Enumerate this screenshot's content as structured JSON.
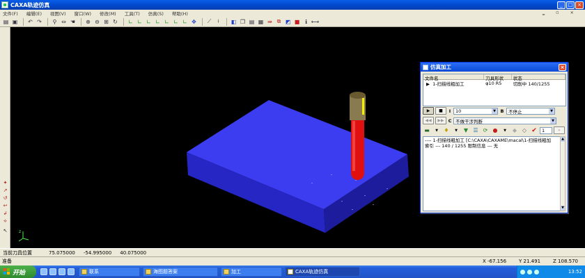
{
  "window": {
    "title": "CAXA轨迹仿真",
    "min": "_",
    "max": "□",
    "close": "×"
  },
  "menu": {
    "items": [
      "文件(F)",
      "编辑(E)",
      "视图(V)",
      "窗口(W)",
      "修改(M)",
      "工具(T)",
      "仿真(S)",
      "帮助(H)"
    ]
  },
  "coords": {
    "label": "当前刀具位置",
    "x": "75.075000",
    "y": "-54.995000",
    "z": "40.075000"
  },
  "status": {
    "ready": "准备",
    "x": "X  -67.156",
    "y": "Y  21.491",
    "z": "Z  108.570"
  },
  "dialog": {
    "title": "仿真加工",
    "close": "×",
    "headers": [
      "文件名",
      "刀具形状",
      "状态"
    ],
    "row": {
      "name": "1-扫描线粗加工",
      "tool": "φ10 R5",
      "state": "切削中 140/1255"
    },
    "i_label": "I",
    "i_value": "10",
    "b_label": "B",
    "b_value": "不停止",
    "c_label": "C",
    "c_value": "不做干涉判断",
    "step_value": "1",
    "info_line1": "---- 1-扫描线粗加工 [C:\\CAXA\\CAXAME\\macal\\1-扫描线粗加",
    "info_line2": "索引 ---     140 / 1255    限制信息 --- 无"
  },
  "taskbar": {
    "start": "开始",
    "tasks": [
      "联系",
      "海图题答案",
      "加工",
      "CAXA轨迹仿真"
    ],
    "clock": "13:52"
  },
  "scene": {
    "block_color": "#3c3cf0",
    "tool_color": "#e01010",
    "holder_color": "#8a7a50"
  }
}
